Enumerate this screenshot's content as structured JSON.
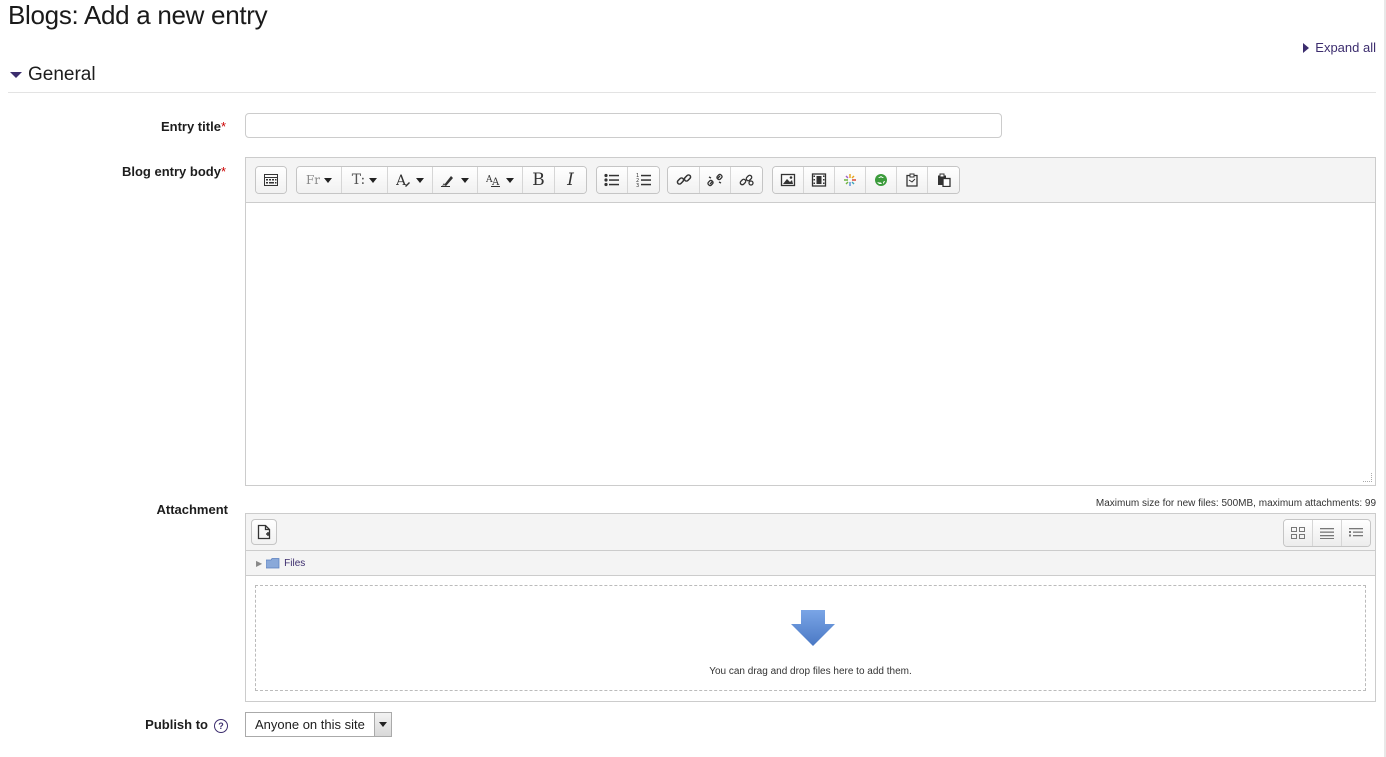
{
  "page": {
    "title": "Blogs: Add a new entry",
    "expand_all": "Expand all"
  },
  "section": {
    "title": "General"
  },
  "fields": {
    "entry_title": {
      "label": "Entry title",
      "required_mark": "*",
      "value": ""
    },
    "body": {
      "label": "Blog entry body",
      "required_mark": "*"
    },
    "attachment": {
      "label": "Attachment",
      "limits": "Maximum size for new files: 500MB, maximum attachments: 99",
      "folder": "Files",
      "drop_text": "You can drag and drop files here to add them."
    },
    "publish_to": {
      "label": "Publish to",
      "help": "?",
      "value": "Anyone on this site"
    }
  },
  "toolbar": {
    "font_family": "Fr",
    "font_size": "T:",
    "bold": "B",
    "italic": "I"
  },
  "colors": {
    "accent": "#3c2d6e",
    "required": "#cc0000",
    "drop_arrow": "#5b8bd8"
  }
}
